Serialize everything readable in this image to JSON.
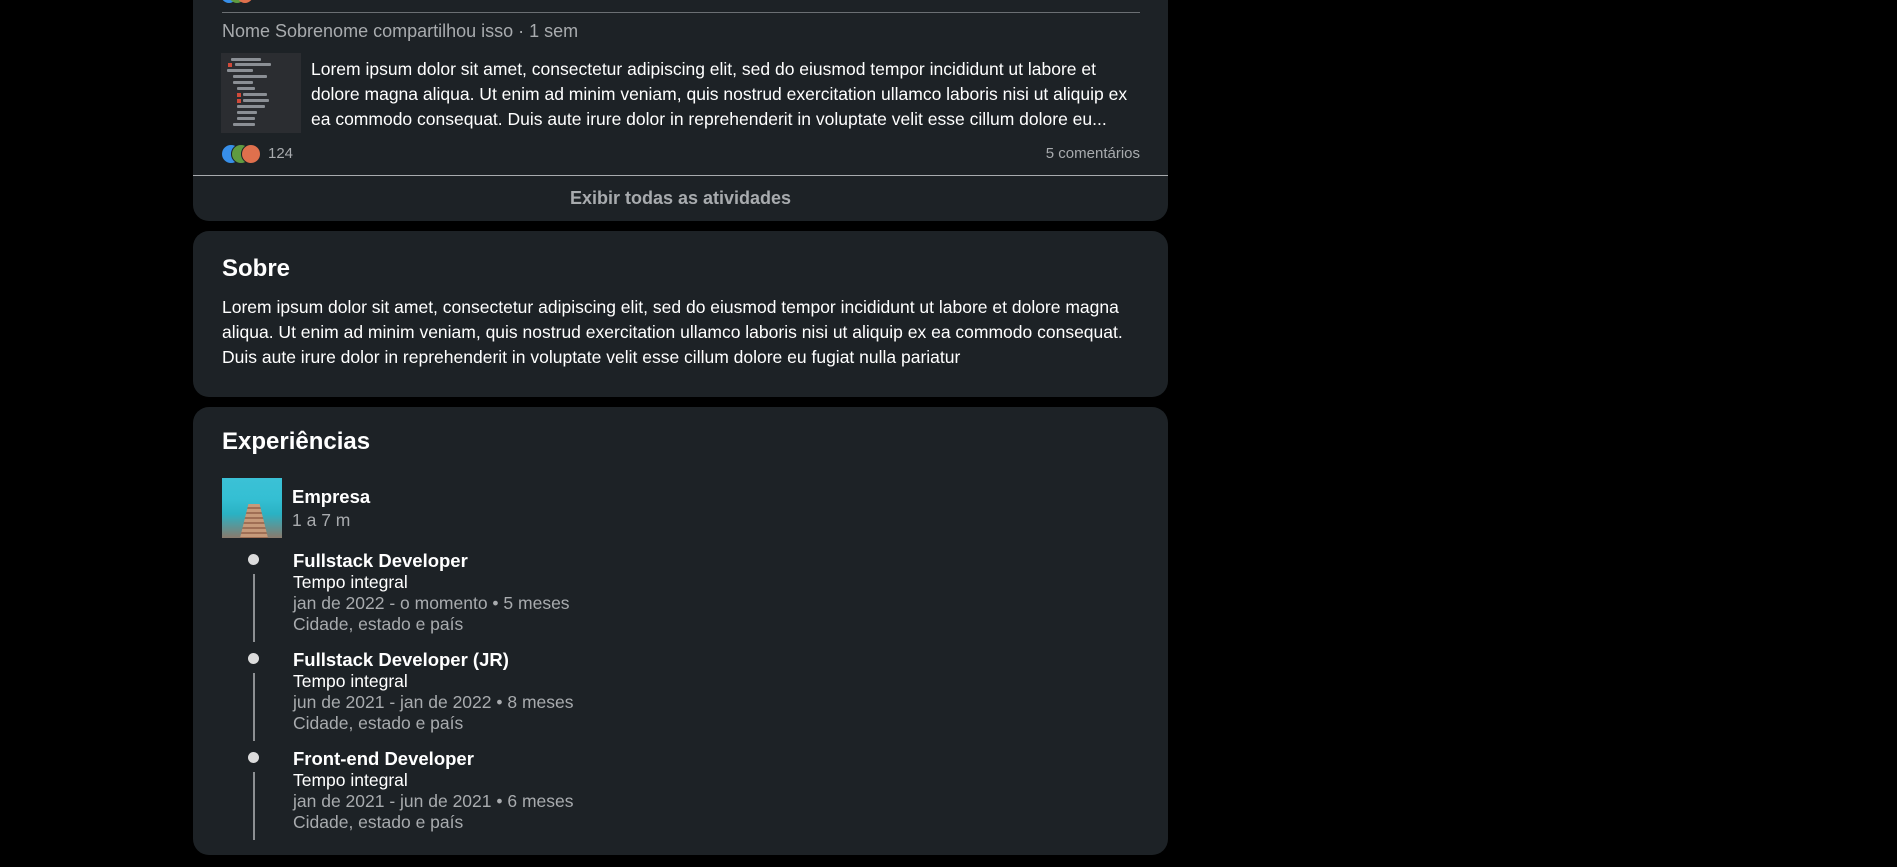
{
  "activity": {
    "share_line": "Nome Sobrenome compartilhou isso · 1 sem",
    "post_text": "Lorem ipsum dolor sit amet, consectetur adipiscing elit, sed do eiusmod tempor incididunt ut labore et dolore magna aliqua. Ut enim ad minim veniam, quis nostrud exercitation ullamco laboris nisi ut aliquip ex ea commodo consequat. Duis aute irure dolor in reprehenderit in voluptate velit esse cillum dolore eu...",
    "reaction_count": "124",
    "comments": "5 comentários",
    "show_all_label": "Exibir todas as atividades",
    "reaction_icon_names": [
      "like-icon",
      "celebrate-icon",
      "love-icon"
    ],
    "reaction_colors": [
      "#378fe9",
      "#5f9b41",
      "#df704d"
    ]
  },
  "about": {
    "title": "Sobre",
    "text": "Lorem ipsum dolor sit amet, consectetur adipiscing elit, sed do eiusmod tempor incididunt ut labore et dolore magna aliqua. Ut enim ad minim veniam, quis nostrud exercitation ullamco laboris nisi ut aliquip ex ea commodo consequat. Duis aute irure dolor in reprehenderit in voluptate velit esse cillum dolore eu fugiat nulla pariatur"
  },
  "experience": {
    "title": "Experiências",
    "company": {
      "name": "Empresa",
      "duration": "1 a 7 m"
    },
    "roles": [
      {
        "title": "Fullstack Developer",
        "type": "Tempo integral",
        "period": "jan de 2022 - o momento • 5 meses",
        "location": "Cidade, estado e país"
      },
      {
        "title": "Fullstack Developer (JR)",
        "type": "Tempo integral",
        "period": "jun de 2021 - jan de 2022 • 8 meses",
        "location": "Cidade, estado e país"
      },
      {
        "title": "Front-end Developer",
        "type": "Tempo integral",
        "period": "jan de 2021 - jun de 2021 • 6 meses",
        "location": "Cidade, estado e país"
      }
    ]
  },
  "colors": {
    "page_background": "#000000",
    "card_background": "#1d2226",
    "primary_text": "#ffffff",
    "secondary_text": "#a8abae"
  }
}
